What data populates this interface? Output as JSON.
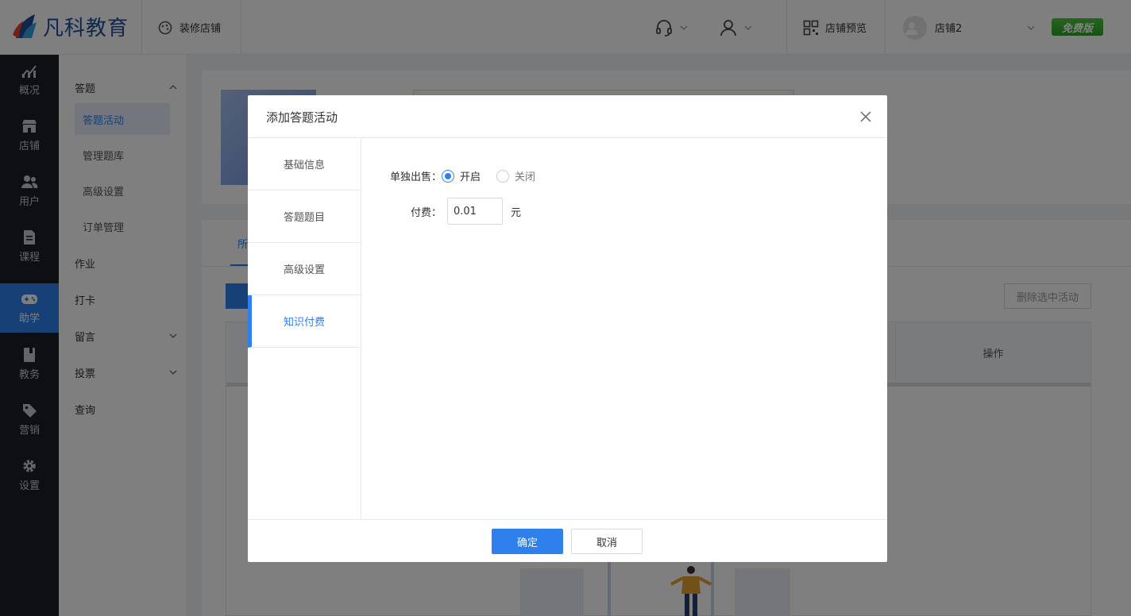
{
  "header": {
    "brand": "凡科教育",
    "decorate_label": "装修店铺",
    "preview_label": "店铺预览",
    "shop_name": "店铺2",
    "edition_badge": "免费版",
    "icons": [
      "palette-icon",
      "headset-icon",
      "user-icon",
      "qrcode-icon",
      "avatar-icon"
    ]
  },
  "nav": {
    "items": [
      {
        "label": "概况",
        "icon": "chart-icon"
      },
      {
        "label": "店铺",
        "icon": "store-icon"
      },
      {
        "label": "用户",
        "icon": "users-icon"
      },
      {
        "label": "课程",
        "icon": "document-icon"
      },
      {
        "label": "助学",
        "icon": "gamepad-icon"
      },
      {
        "label": "教务",
        "icon": "book-icon"
      },
      {
        "label": "营销",
        "icon": "tag-icon"
      },
      {
        "label": "设置",
        "icon": "gear-icon"
      }
    ],
    "active": "助学"
  },
  "submenu": {
    "group_answer": "答题",
    "answer_items": [
      "答题活动",
      "管理题库",
      "高级设置",
      "订单管理"
    ],
    "homework": "作业",
    "checkin": "打卡",
    "message": "留言",
    "vote": "投票",
    "query": "查询"
  },
  "page": {
    "tab_all": "所",
    "delete_selected": "删除选中活动",
    "col_operation": "操作"
  },
  "modal": {
    "title": "添加答题活动",
    "tabs": [
      "基础信息",
      "答题题目",
      "高级设置",
      "知识付费"
    ],
    "active_tab": "知识付费",
    "sell_separately_label": "单独出售：",
    "option_on": "开启",
    "option_off": "关闭",
    "fee_label": "付费：",
    "fee_value": "0.01",
    "fee_unit": "元",
    "confirm": "确定",
    "cancel": "取消"
  },
  "colors": {
    "accent": "#2f80ed",
    "sidebar_dark": "#1c1e26",
    "badge_green": "#3bb534"
  }
}
